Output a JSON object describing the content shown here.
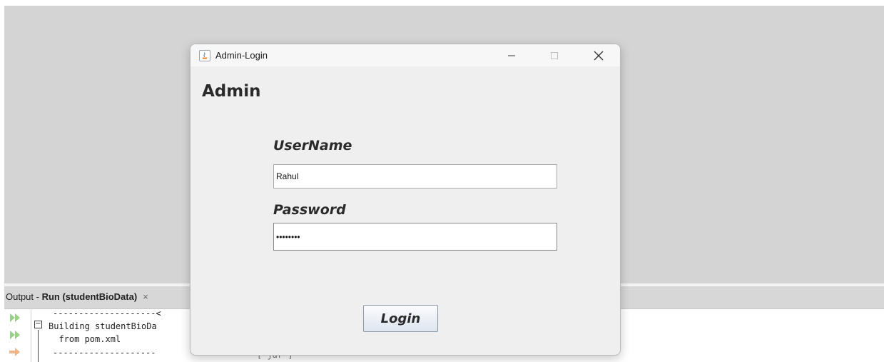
{
  "output_panel": {
    "tab_prefix": "Output - ",
    "tab_run_label": "Run (studentBioData)",
    "tab_close": "×",
    "console_lines": [
      "--------------------<",
      "Building studentBioDa",
      "  from pom.xml",
      "--------------------"
    ],
    "console_overflow_fragment": "[ jar ]",
    "gutter_icons": [
      "rerun-icon",
      "rerun-alt-icon",
      "stop-arrow-icon"
    ]
  },
  "dialog": {
    "title": "Admin-Login",
    "icon": "java-icon",
    "heading": "Admin",
    "username_label": "UserName",
    "username_value": "Rahul",
    "password_label": "Password",
    "password_value": "secret12",
    "login_button": "Login"
  },
  "colors": {
    "ide_background": "#d4d4d4",
    "dialog_background": "#efefef",
    "button_border": "#8c9aaa"
  }
}
